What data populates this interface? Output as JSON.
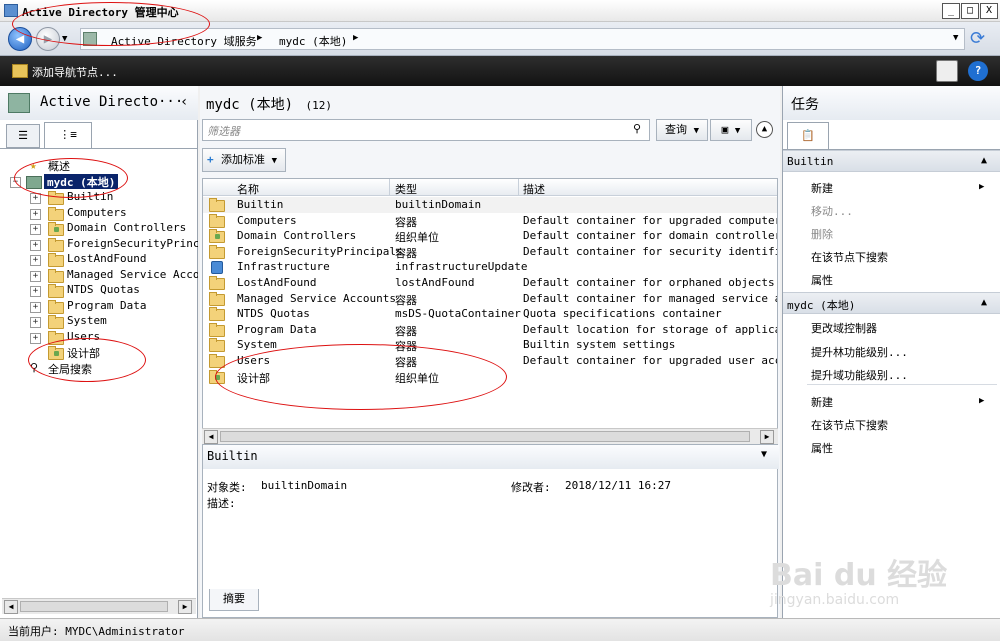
{
  "window": {
    "title": "Active Directory 管理中心",
    "buttons": [
      "_",
      "□",
      "X"
    ]
  },
  "address": {
    "crumbs": [
      "Active Directory 域服务",
      "mydc (本地)"
    ]
  },
  "toolbar": {
    "add_nav_node": "添加导航节点..."
  },
  "left_pane": {
    "title": "Active Directo···",
    "tree": [
      {
        "label": "概述",
        "level": 0,
        "icon": "overview-icon"
      },
      {
        "label": "mydc (本地)",
        "level": 0,
        "icon": "domain-icon",
        "selected": true
      },
      {
        "label": "Builtin",
        "level": 1,
        "icon": "folder-icon"
      },
      {
        "label": "Computers",
        "level": 1,
        "icon": "folder-icon"
      },
      {
        "label": "Domain Controllers",
        "level": 1,
        "icon": "ou-icon"
      },
      {
        "label": "ForeignSecurityPrincipals",
        "level": 1,
        "icon": "folder-icon"
      },
      {
        "label": "LostAndFound",
        "level": 1,
        "icon": "folder-icon"
      },
      {
        "label": "Managed Service Accounts",
        "level": 1,
        "icon": "folder-icon"
      },
      {
        "label": "NTDS Quotas",
        "level": 1,
        "icon": "folder-icon"
      },
      {
        "label": "Program Data",
        "level": 1,
        "icon": "folder-icon"
      },
      {
        "label": "System",
        "level": 1,
        "icon": "folder-icon"
      },
      {
        "label": "Users",
        "level": 1,
        "icon": "folder-icon"
      },
      {
        "label": "设计部",
        "level": 1,
        "icon": "ou-icon"
      },
      {
        "label": "全局搜索",
        "level": 0,
        "icon": "search-icon"
      }
    ]
  },
  "center": {
    "title": "mydc (本地)",
    "count": "(12)",
    "filter_placeholder": "筛选器",
    "query_label": "查询",
    "add_criteria": "添加标准",
    "columns": [
      "名称",
      "类型",
      "描述"
    ],
    "rows": [
      {
        "name": "Builtin",
        "type": "builtinDomain",
        "desc": "",
        "icon": "folder-icon"
      },
      {
        "name": "Computers",
        "type": "容器",
        "desc": "Default container for upgraded computer acc",
        "icon": "folder-icon"
      },
      {
        "name": "Domain Controllers",
        "type": "组织单位",
        "desc": "Default container for domain controllers",
        "icon": "ou-icon"
      },
      {
        "name": "ForeignSecurityPrincipals",
        "type": "容器",
        "desc": "Default container for security identifiers",
        "icon": "folder-icon"
      },
      {
        "name": "Infrastructure",
        "type": "infrastructureUpdate",
        "desc": "",
        "icon": "infrastructure-icon"
      },
      {
        "name": "LostAndFound",
        "type": "lostAndFound",
        "desc": "Default container for orphaned objects",
        "icon": "folder-icon"
      },
      {
        "name": "Managed Service Accounts",
        "type": "容器",
        "desc": "Default container for managed service accou",
        "icon": "folder-icon"
      },
      {
        "name": "NTDS Quotas",
        "type": "msDS-QuotaContainer",
        "desc": "Quota specifications container",
        "icon": "folder-icon"
      },
      {
        "name": "Program Data",
        "type": "容器",
        "desc": "Default location for storage of application",
        "icon": "folder-icon"
      },
      {
        "name": "System",
        "type": "容器",
        "desc": "Builtin system settings",
        "icon": "folder-icon"
      },
      {
        "name": "Users",
        "type": "容器",
        "desc": "Default container for upgraded user account",
        "icon": "folder-icon"
      },
      {
        "name": "设计部",
        "type": "组织单位",
        "desc": "",
        "icon": "ou-icon"
      }
    ],
    "detail": {
      "title": "Builtin",
      "object_class_label": "对象类:",
      "object_class_value": "builtinDomain",
      "modified_label": "修改者:",
      "modified_value": "2018/12/11 16:27",
      "desc_label": "描述:",
      "tab": "摘要"
    }
  },
  "right_pane": {
    "title": "任务",
    "sections": [
      {
        "title": "Builtin",
        "items": [
          {
            "label": "新建",
            "submenu": true,
            "enabled": true
          },
          {
            "label": "移动...",
            "enabled": false
          },
          {
            "label": "删除",
            "enabled": false
          },
          {
            "label": "在该节点下搜索",
            "enabled": true
          },
          {
            "label": "属性",
            "enabled": true
          }
        ]
      },
      {
        "title": "mydc (本地)",
        "items": [
          {
            "label": "更改域控制器",
            "enabled": true
          },
          {
            "label": "提升林功能级别...",
            "enabled": true
          },
          {
            "label": "提升域功能级别...",
            "enabled": true
          },
          {
            "label": "新建",
            "submenu": true,
            "enabled": true
          },
          {
            "label": "在该节点下搜索",
            "enabled": true
          },
          {
            "label": "属性",
            "enabled": true
          }
        ]
      }
    ]
  },
  "status": {
    "text": "当前用户: MYDC\\Administrator"
  },
  "watermark": {
    "brand": "Bai du 经验",
    "url": "jingyan.baidu.com"
  },
  "colors": {
    "annotation": "#dd1111",
    "selection": "#0a246a",
    "accent": "#1d5fbf"
  }
}
